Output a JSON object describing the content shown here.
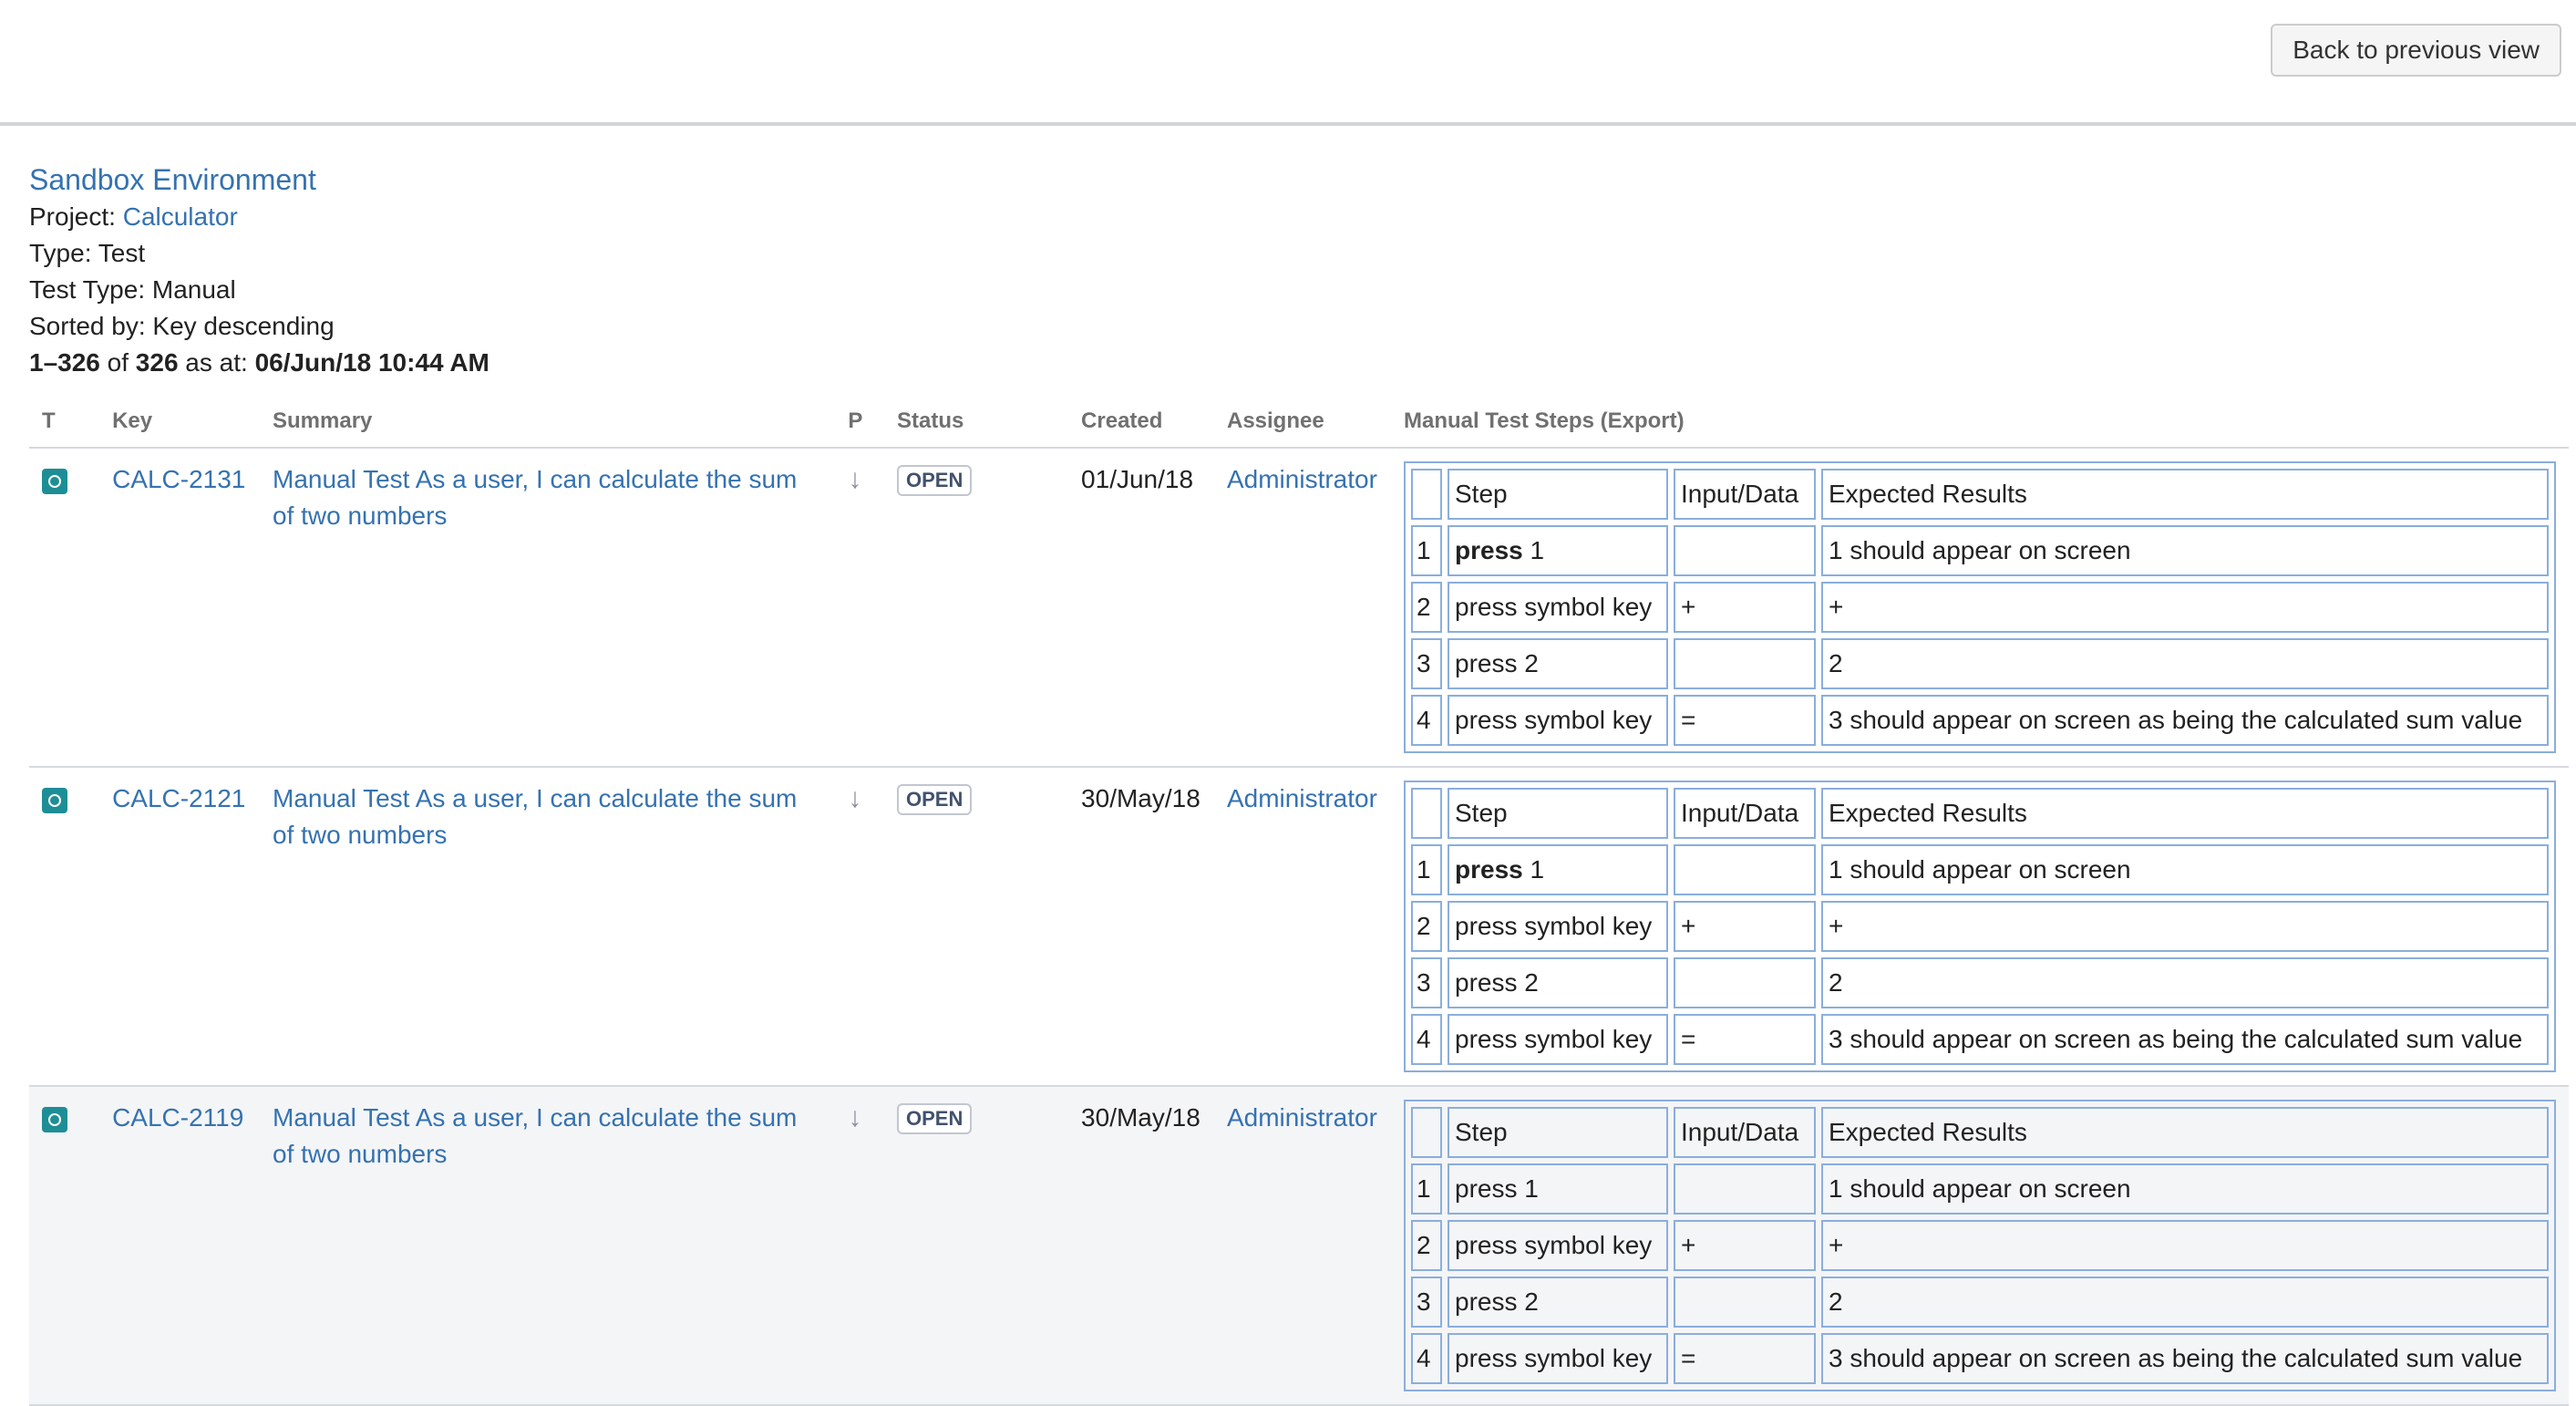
{
  "toolbar": {
    "back_label": "Back to previous view"
  },
  "header": {
    "environment": "Sandbox Environment",
    "project_label": "Project:",
    "project_value": "Calculator",
    "type_line": "Type: Test",
    "test_type_line": "Test Type: Manual",
    "sorted_line": "Sorted by: Key descending",
    "count": {
      "range": "1–326",
      "of": "of",
      "total": "326",
      "as_at": "as at:",
      "timestamp": "06/Jun/18 10:44 AM"
    }
  },
  "columns": {
    "type": "T",
    "key": "Key",
    "summary": "Summary",
    "priority": "P",
    "status": "Status",
    "created": "Created",
    "assignee": "Assignee",
    "steps": "Manual Test Steps (Export)"
  },
  "steps_headers": {
    "step": "Step",
    "input": "Input/Data",
    "expected": "Expected Results"
  },
  "issues": [
    {
      "key": "CALC-2131",
      "summary": "Manual Test As a user, I can calculate the sum of two numbers",
      "priority_icon": "↓",
      "status": "OPEN",
      "created": "01/Jun/18",
      "assignee": "Administrator",
      "steps": [
        {
          "n": "1",
          "step_bold": "press",
          "step_rest": " 1",
          "input": "",
          "expected": "1 should appear on screen"
        },
        {
          "n": "2",
          "step_bold": "",
          "step_rest": "press symbol key",
          "input": "+",
          "expected": "+"
        },
        {
          "n": "3",
          "step_bold": "",
          "step_rest": "press 2",
          "input": "",
          "expected": "2"
        },
        {
          "n": "4",
          "step_bold": "",
          "step_rest": "press symbol key",
          "input": "=",
          "expected": "3 should appear on screen as being the calculated sum value"
        }
      ]
    },
    {
      "key": "CALC-2121",
      "summary": "Manual Test As a user, I can calculate the sum of two numbers",
      "priority_icon": "↓",
      "status": "OPEN",
      "created": "30/May/18",
      "assignee": "Administrator",
      "steps": [
        {
          "n": "1",
          "step_bold": "press",
          "step_rest": " 1",
          "input": "",
          "expected": "1 should appear on screen"
        },
        {
          "n": "2",
          "step_bold": "",
          "step_rest": "press symbol key",
          "input": "+",
          "expected": "+"
        },
        {
          "n": "3",
          "step_bold": "",
          "step_rest": "press 2",
          "input": "",
          "expected": "2"
        },
        {
          "n": "4",
          "step_bold": "",
          "step_rest": "press symbol key",
          "input": "=",
          "expected": "3 should appear on screen as being the calculated sum value"
        }
      ]
    },
    {
      "key": "CALC-2119",
      "summary": "Manual Test As a user, I can calculate the sum of two numbers",
      "priority_icon": "↓",
      "status": "OPEN",
      "created": "30/May/18",
      "assignee": "Administrator",
      "steps": [
        {
          "n": "1",
          "step_bold": "",
          "step_rest": "press 1",
          "input": "",
          "expected": "1 should appear on screen"
        },
        {
          "n": "2",
          "step_bold": "",
          "step_rest": "press symbol key",
          "input": "+",
          "expected": "+"
        },
        {
          "n": "3",
          "step_bold": "",
          "step_rest": "press 2",
          "input": "",
          "expected": "2"
        },
        {
          "n": "4",
          "step_bold": "",
          "step_rest": "press symbol key",
          "input": "=",
          "expected": "3 should appear on screen as being the calculated sum value"
        }
      ]
    }
  ],
  "icons": {
    "issue_type": "test-issue-type-icon",
    "priority": "low-priority-arrow-icon"
  },
  "colors": {
    "link": "#3572b0",
    "type_icon": "#1e8e96",
    "step_border": "#8aaedc",
    "shaded_row": "#f4f5f7"
  }
}
